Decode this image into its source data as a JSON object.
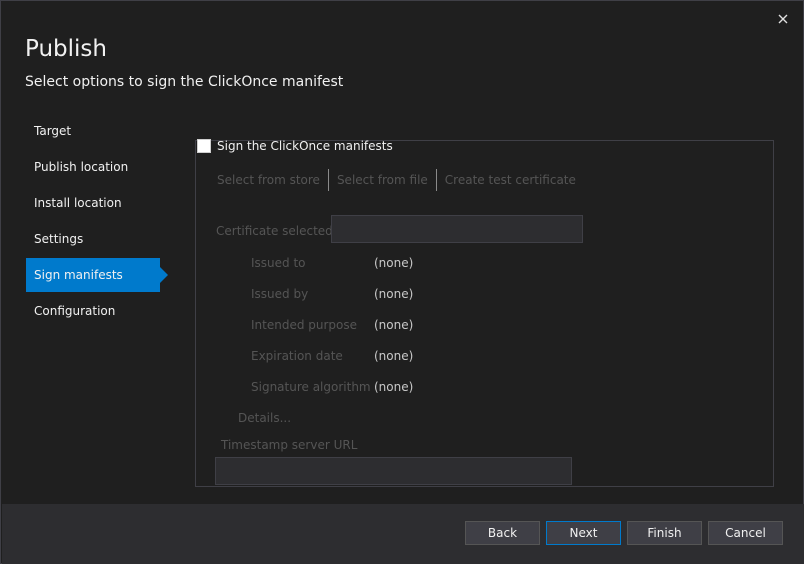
{
  "window": {
    "title": "Publish",
    "subtitle": "Select options to sign the ClickOnce manifest"
  },
  "nav": {
    "items": [
      {
        "label": "Target"
      },
      {
        "label": "Publish location"
      },
      {
        "label": "Install location"
      },
      {
        "label": "Settings"
      },
      {
        "label": "Sign manifests",
        "active": true
      },
      {
        "label": "Configuration"
      }
    ]
  },
  "sign": {
    "checkbox_label": "Sign the ClickOnce manifests",
    "checked": false,
    "sources": [
      "Select from store",
      "Select from file",
      "Create test certificate"
    ],
    "certificate_label": "Certificate selected",
    "certificate_value": "",
    "fields": [
      {
        "label": "Issued to",
        "value": "(none)"
      },
      {
        "label": "Issued by",
        "value": "(none)"
      },
      {
        "label": "Intended purpose",
        "value": "(none)"
      },
      {
        "label": "Expiration date",
        "value": "(none)"
      },
      {
        "label": "Signature algorithm",
        "value": "(none)"
      }
    ],
    "details_label": "Details...",
    "timestamp_label": "Timestamp server URL",
    "timestamp_value": ""
  },
  "buttons": {
    "back": "Back",
    "next": "Next",
    "finish": "Finish",
    "cancel": "Cancel"
  },
  "colors": {
    "accent": "#007acc",
    "background": "#1f1f1f",
    "footer": "#2d2d30"
  }
}
